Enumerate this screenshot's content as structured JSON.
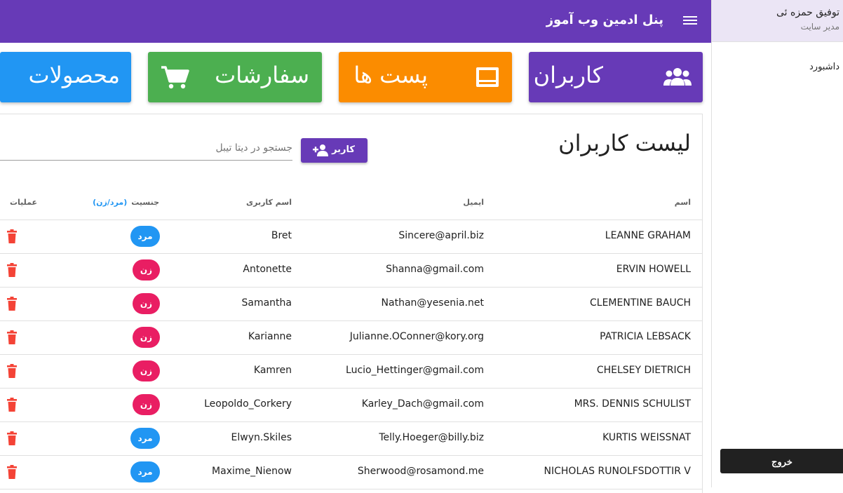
{
  "app": {
    "title": "پنل ادمین وب آموز",
    "menu_icon": "menu-icon",
    "colors": {
      "primary": "#673ab7",
      "posts": "#fb8c00",
      "orders": "#4caf50",
      "products": "#2196f3",
      "male": "#2196f3",
      "female": "#e91e63",
      "delete": "#f44336"
    }
  },
  "drawer": {
    "user_name": "توفیق حمزه ئی",
    "user_role": "مدیر سایت",
    "nav_dashboard": "داشبورد",
    "logout_label": "خروج"
  },
  "cards": {
    "users": {
      "label": "کاربران",
      "icon": "group-icon"
    },
    "posts": {
      "label": "پست ها",
      "icon": "article-icon"
    },
    "orders": {
      "label": "سفارشات",
      "icon": "cart-icon"
    },
    "products": {
      "label": "محصولات"
    }
  },
  "list": {
    "title": "لیست کاربران",
    "add_button_label": "کاربر",
    "search_placeholder": "جستجو در دیتا تیبل",
    "columns": {
      "name": "اسم",
      "email": "ایمیل",
      "username": "اسم کاربری",
      "gender": "جنسیت",
      "gender_hint": "(مرد/زن)",
      "actions": "عملیات"
    },
    "rows": [
      {
        "name": "LEANNE GRAHAM",
        "email": "Sincere@april.biz",
        "username": "Bret",
        "gender": "مرد",
        "gender_type": "male"
      },
      {
        "name": "ERVIN HOWELL",
        "email": "Shanna@gmail.com",
        "username": "Antonette",
        "gender": "زن",
        "gender_type": "female"
      },
      {
        "name": "CLEMENTINE BAUCH",
        "email": "Nathan@yesenia.net",
        "username": "Samantha",
        "gender": "زن",
        "gender_type": "female"
      },
      {
        "name": "PATRICIA LEBSACK",
        "email": "Julianne.OConner@kory.org",
        "username": "Karianne",
        "gender": "زن",
        "gender_type": "female"
      },
      {
        "name": "CHELSEY DIETRICH",
        "email": "Lucio_Hettinger@gmail.com",
        "username": "Kamren",
        "gender": "زن",
        "gender_type": "female"
      },
      {
        "name": "MRS. DENNIS SCHULIST",
        "email": "Karley_Dach@gmail.com",
        "username": "Leopoldo_Corkery",
        "gender": "زن",
        "gender_type": "female"
      },
      {
        "name": "KURTIS WEISSNAT",
        "email": "Telly.Hoeger@billy.biz",
        "username": "Elwyn.Skiles",
        "gender": "مرد",
        "gender_type": "male"
      },
      {
        "name": "NICHOLAS RUNOLFSDOTTIR V",
        "email": "Sherwood@rosamond.me",
        "username": "Maxime_Nienow",
        "gender": "مرد",
        "gender_type": "male"
      }
    ]
  }
}
